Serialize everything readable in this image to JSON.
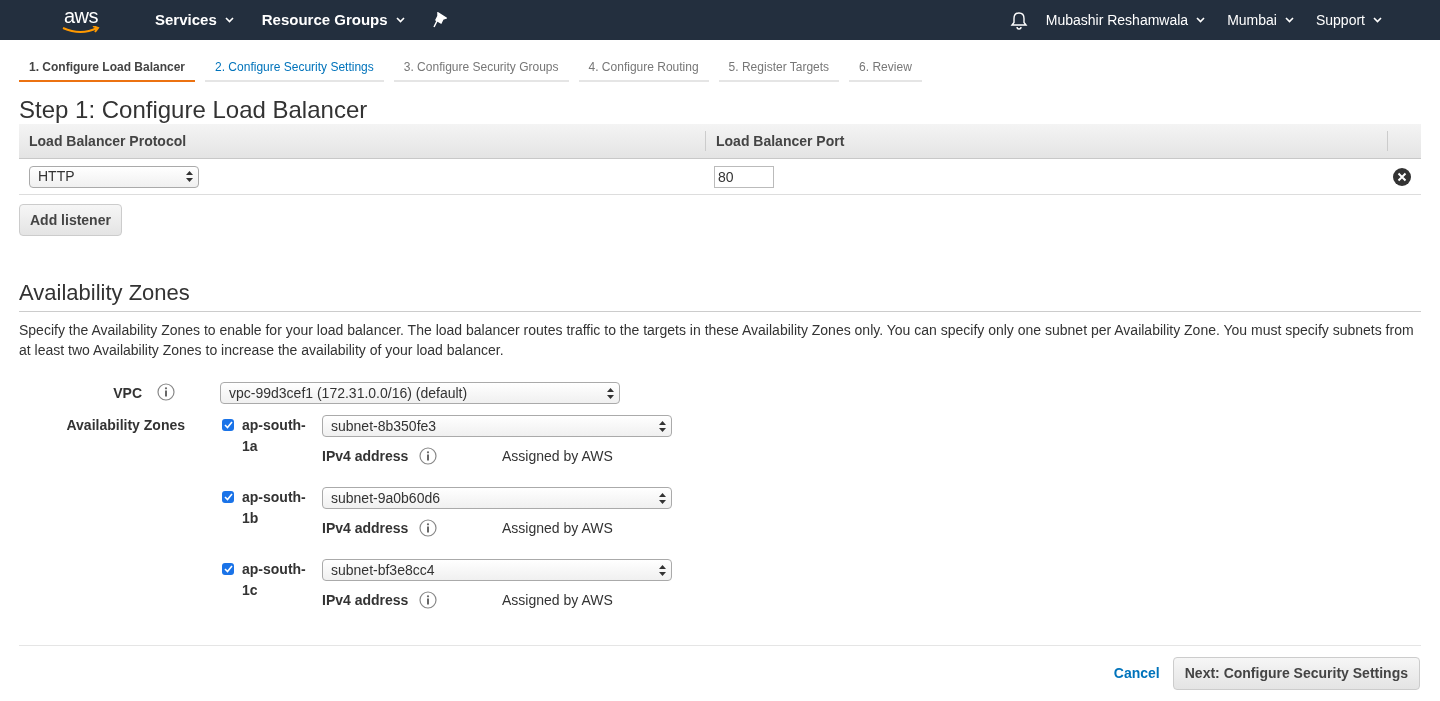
{
  "navbar": {
    "logo": "aws",
    "menus": [
      {
        "label": "Services"
      },
      {
        "label": "Resource Groups"
      }
    ],
    "right_menus": [
      {
        "label": "Mubashir Reshamwala"
      },
      {
        "label": "Mumbai"
      },
      {
        "label": "Support"
      }
    ]
  },
  "wizard_tabs": [
    {
      "label": "1. Configure Load Balancer",
      "selected": true,
      "disabled": false
    },
    {
      "label": "2. Configure Security Settings",
      "selected": false,
      "disabled": false
    },
    {
      "label": "3. Configure Security Groups",
      "selected": false,
      "disabled": true
    },
    {
      "label": "4. Configure Routing",
      "selected": false,
      "disabled": true
    },
    {
      "label": "5. Register Targets",
      "selected": false,
      "disabled": true
    },
    {
      "label": "6. Review",
      "selected": false,
      "disabled": true
    }
  ],
  "title": "Step 1: Configure Load Balancer",
  "listeners": {
    "columns": [
      "Load Balancer Protocol",
      "Load Balancer Port"
    ],
    "rows": [
      {
        "protocol": "HTTP",
        "port": "80"
      }
    ],
    "add_button": "Add listener"
  },
  "availability": {
    "heading": "Availability Zones",
    "description": "Specify the Availability Zones to enable for your load balancer. The load balancer routes traffic to the targets in these Availability Zones only. You can specify only one subnet per Availability Zone. You must specify subnets from at least two Availability Zones to increase the availability of your load balancer.",
    "vpc_label": "VPC",
    "vpc_value": "vpc-99d3cef1 (172.31.0.0/16) (default)",
    "zones_label": "Availability Zones",
    "zones": [
      {
        "name": "ap-south-1a",
        "checked": true,
        "subnet": "subnet-8b350fe3",
        "ipv4_label": "IPv4 address",
        "ipv4_value": "Assigned by AWS"
      },
      {
        "name": "ap-south-1b",
        "checked": true,
        "subnet": "subnet-9a0b60d6",
        "ipv4_label": "IPv4 address",
        "ipv4_value": "Assigned by AWS"
      },
      {
        "name": "ap-south-1c",
        "checked": true,
        "subnet": "subnet-bf3e8cc4",
        "ipv4_label": "IPv4 address",
        "ipv4_value": "Assigned by AWS"
      }
    ]
  },
  "footer": {
    "cancel": "Cancel",
    "next": "Next: Configure Security Settings"
  }
}
